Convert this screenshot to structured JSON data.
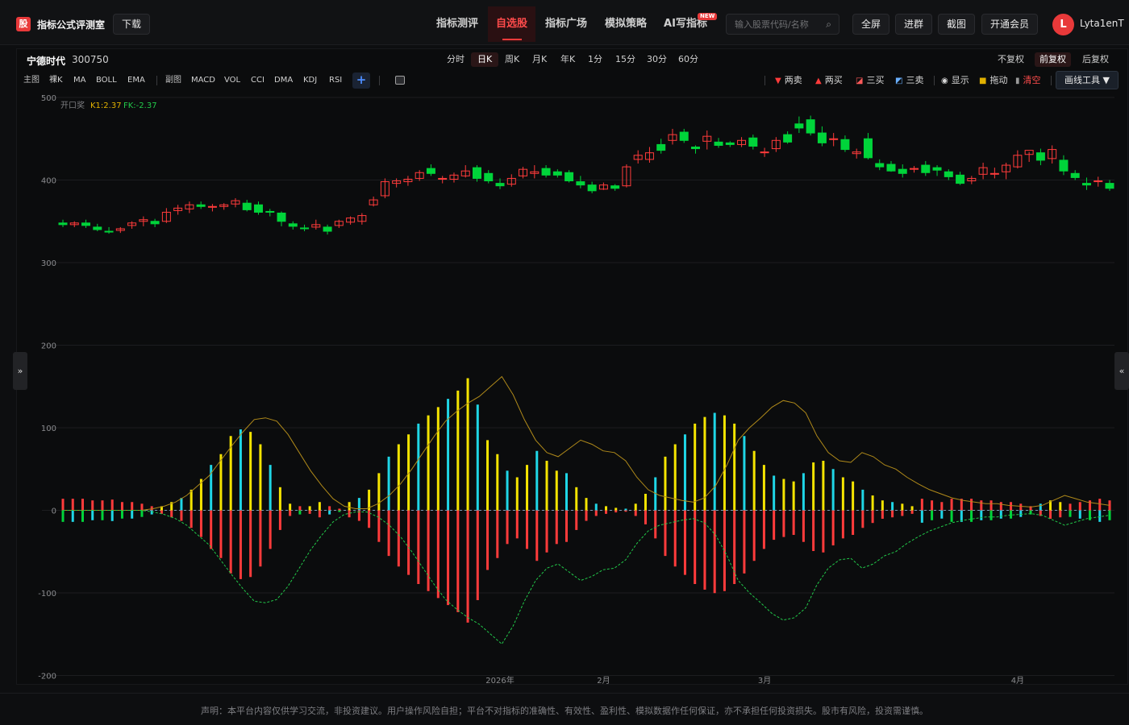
{
  "header": {
    "logo_char": "股",
    "app_title": "指标公式评测室",
    "download_label": "下载",
    "nav": [
      {
        "label": "指标测评",
        "active": false
      },
      {
        "label": "自选股",
        "active": true
      },
      {
        "label": "指标广场",
        "active": false
      },
      {
        "label": "模拟策略",
        "active": false
      },
      {
        "label": "AI写指标",
        "active": false
      }
    ],
    "new_badge": "NEW",
    "search_placeholder": "输入股票代码/名称",
    "buttons": {
      "fullscreen": "全屏",
      "join_group": "进群",
      "screenshot": "截图",
      "membership": "开通会员"
    },
    "user": {
      "avatar_letter": "L",
      "name": "Lyta1enT"
    }
  },
  "stock": {
    "name": "宁德时代",
    "code": "300750"
  },
  "periods": [
    {
      "label": "分时",
      "active": false
    },
    {
      "label": "日K",
      "active": true
    },
    {
      "label": "周K",
      "active": false
    },
    {
      "label": "月K",
      "active": false
    },
    {
      "label": "年K",
      "active": false
    },
    {
      "label": "1分",
      "active": false
    },
    {
      "label": "15分",
      "active": false
    },
    {
      "label": "30分",
      "active": false
    },
    {
      "label": "60分",
      "active": false
    }
  ],
  "adjust": [
    {
      "label": "不复权",
      "active": false
    },
    {
      "label": "前复权",
      "active": true
    },
    {
      "label": "后复权",
      "active": false
    }
  ],
  "indicator_bar": {
    "main_label": "主图",
    "main_items": [
      "裸K",
      "MA",
      "BOLL",
      "EMA"
    ],
    "sub_label": "副图",
    "sub_items": [
      "MACD",
      "VOL",
      "CCI",
      "DMA",
      "KDJ",
      "RSI"
    ],
    "add_label": "+"
  },
  "tools": {
    "two_sell": "两卖",
    "two_buy": "两买",
    "three_buy": "三买",
    "three_sell": "三卖",
    "show": "显示",
    "drag": "拖动",
    "clear": "清空",
    "draw_tools": "画线工具 ▼"
  },
  "colors": {
    "up": "#ff3b3b",
    "down": "#00d43a",
    "k1": "#e0b000",
    "fk": "#22c94a",
    "cyan": "#1fd6e6",
    "yellow": "#f5e400"
  },
  "chart_data": {
    "type": "candlestick+oscillator",
    "legend": {
      "name": "开口奖",
      "k1": "K1:2.37",
      "fk": "FK:-2.37"
    },
    "ylim": [
      -200,
      500
    ],
    "y_ticks": [
      500,
      400,
      300,
      200,
      100,
      0,
      -100,
      -200
    ],
    "x_tick_labels": [
      {
        "label": "2026年",
        "index": 38
      },
      {
        "label": "2月",
        "index": 47
      },
      {
        "label": "3月",
        "index": 61
      },
      {
        "label": "4月",
        "index": 83
      }
    ],
    "candles": [
      [
        348,
        352,
        343,
        346
      ],
      [
        346,
        350,
        343,
        348
      ],
      [
        348,
        352,
        342,
        345
      ],
      [
        343,
        347,
        338,
        340
      ],
      [
        338,
        343,
        335,
        337
      ],
      [
        339,
        343,
        336,
        341
      ],
      [
        345,
        350,
        341,
        348
      ],
      [
        350,
        356,
        344,
        352
      ],
      [
        350,
        353,
        343,
        347
      ],
      [
        350,
        366,
        348,
        361
      ],
      [
        363,
        370,
        358,
        366
      ],
      [
        365,
        374,
        360,
        370
      ],
      [
        370,
        374,
        365,
        368
      ],
      [
        367,
        371,
        362,
        368
      ],
      [
        368,
        372,
        364,
        370
      ],
      [
        371,
        378,
        367,
        375
      ],
      [
        372,
        376,
        362,
        364
      ],
      [
        370,
        374,
        358,
        361
      ],
      [
        362,
        365,
        356,
        361
      ],
      [
        360,
        362,
        344,
        350
      ],
      [
        347,
        350,
        340,
        344
      ],
      [
        342,
        346,
        338,
        341
      ],
      [
        343,
        352,
        340,
        346
      ],
      [
        343,
        346,
        334,
        338
      ],
      [
        345,
        352,
        342,
        350
      ],
      [
        349,
        356,
        346,
        354
      ],
      [
        350,
        360,
        346,
        357
      ],
      [
        370,
        380,
        368,
        376
      ],
      [
        381,
        402,
        378,
        398
      ],
      [
        396,
        402,
        391,
        399
      ],
      [
        398,
        405,
        393,
        401
      ],
      [
        402,
        412,
        399,
        409
      ],
      [
        414,
        419,
        405,
        408
      ],
      [
        401,
        405,
        396,
        402
      ],
      [
        401,
        409,
        397,
        406
      ],
      [
        405,
        418,
        403,
        411
      ],
      [
        415,
        418,
        398,
        402
      ],
      [
        408,
        412,
        396,
        399
      ],
      [
        396,
        402,
        389,
        393
      ],
      [
        395,
        407,
        392,
        402
      ],
      [
        405,
        416,
        402,
        413
      ],
      [
        408,
        418,
        402,
        410
      ],
      [
        414,
        418,
        403,
        406
      ],
      [
        410,
        413,
        403,
        406
      ],
      [
        409,
        412,
        397,
        399
      ],
      [
        398,
        405,
        390,
        394
      ],
      [
        394,
        398,
        384,
        387
      ],
      [
        389,
        397,
        388,
        394
      ],
      [
        393,
        395,
        387,
        390
      ],
      [
        393,
        419,
        391,
        416
      ],
      [
        425,
        436,
        420,
        430
      ],
      [
        425,
        440,
        421,
        433
      ],
      [
        443,
        450,
        432,
        436
      ],
      [
        448,
        462,
        443,
        455
      ],
      [
        458,
        462,
        445,
        448
      ],
      [
        440,
        442,
        432,
        438
      ],
      [
        447,
        460,
        437,
        453
      ],
      [
        446,
        451,
        439,
        442
      ],
      [
        445,
        447,
        440,
        443
      ],
      [
        443,
        452,
        440,
        448
      ],
      [
        451,
        455,
        437,
        441
      ],
      [
        433,
        439,
        428,
        434
      ],
      [
        438,
        452,
        434,
        448
      ],
      [
        455,
        459,
        444,
        446
      ],
      [
        468,
        477,
        457,
        463
      ],
      [
        473,
        478,
        454,
        457
      ],
      [
        457,
        465,
        441,
        445
      ],
      [
        449,
        457,
        441,
        450
      ],
      [
        449,
        454,
        434,
        437
      ],
      [
        432,
        438,
        426,
        434
      ],
      [
        450,
        457,
        425,
        427
      ],
      [
        420,
        425,
        412,
        416
      ],
      [
        419,
        423,
        410,
        411
      ],
      [
        413,
        419,
        403,
        408
      ],
      [
        413,
        417,
        409,
        414
      ],
      [
        418,
        423,
        405,
        409
      ],
      [
        415,
        418,
        405,
        412
      ],
      [
        410,
        413,
        400,
        404
      ],
      [
        406,
        410,
        394,
        396
      ],
      [
        399,
        405,
        395,
        402
      ],
      [
        407,
        421,
        401,
        415
      ],
      [
        407,
        415,
        402,
        408
      ],
      [
        410,
        421,
        401,
        418
      ],
      [
        416,
        436,
        414,
        430
      ],
      [
        431,
        434,
        422,
        436
      ],
      [
        433,
        438,
        418,
        424
      ],
      [
        426,
        442,
        420,
        437
      ],
      [
        424,
        430,
        406,
        411
      ],
      [
        408,
        412,
        400,
        403
      ],
      [
        396,
        403,
        388,
        394
      ],
      [
        398,
        404,
        392,
        399
      ],
      [
        396,
        400,
        387,
        390
      ]
    ],
    "hist": [
      -14,
      -14,
      -14,
      -12,
      -12,
      -13,
      -10,
      -10,
      -8,
      -5,
      5,
      10,
      15,
      25,
      38,
      55,
      68,
      90,
      98,
      95,
      80,
      55,
      28,
      8,
      -5,
      5,
      10,
      -5,
      -2,
      10,
      15,
      25,
      45,
      65,
      80,
      92,
      105,
      115,
      125,
      135,
      145,
      160,
      128,
      85,
      68,
      48,
      40,
      55,
      72,
      60,
      48,
      45,
      28,
      15,
      8,
      5,
      3,
      2,
      8,
      20,
      40,
      65,
      80,
      92,
      105,
      113,
      118,
      115,
      105,
      90,
      72,
      55,
      42,
      38,
      35,
      45,
      58,
      60,
      50,
      40,
      35,
      25,
      18,
      12,
      10,
      8,
      5,
      -15,
      -12,
      -10,
      -14,
      -14,
      -14,
      -12,
      -12,
      -10,
      -10,
      -8,
      -5,
      8,
      12,
      10,
      -8,
      -10,
      -12,
      -14,
      -12
    ],
    "k1_line": [
      0,
      0,
      0,
      0,
      0,
      0,
      0,
      0,
      2,
      5,
      10,
      18,
      30,
      42,
      60,
      78,
      95,
      110,
      112,
      108,
      92,
      70,
      48,
      30,
      14,
      5,
      2,
      2,
      8,
      18,
      32,
      50,
      70,
      90,
      108,
      120,
      130,
      138,
      150,
      162,
      140,
      110,
      85,
      70,
      65,
      75,
      85,
      80,
      72,
      70,
      60,
      40,
      25,
      18,
      15,
      12,
      10,
      15,
      30,
      55,
      85,
      100,
      112,
      125,
      133,
      130,
      118,
      90,
      70,
      60,
      58,
      70,
      65,
      55,
      50,
      40,
      32,
      25,
      20,
      15,
      12,
      10,
      8,
      8,
      6,
      5,
      4,
      6,
      12,
      18,
      14,
      10,
      8,
      6
    ],
    "fk_line": [
      0,
      0,
      0,
      0,
      0,
      0,
      0,
      0,
      -2,
      -5,
      -10,
      -18,
      -30,
      -42,
      -60,
      -78,
      -95,
      -110,
      -112,
      -108,
      -92,
      -70,
      -48,
      -30,
      -14,
      -5,
      -2,
      -2,
      -8,
      -18,
      -32,
      -50,
      -70,
      -90,
      -108,
      -120,
      -130,
      -138,
      -150,
      -162,
      -140,
      -110,
      -85,
      -70,
      -65,
      -75,
      -85,
      -80,
      -72,
      -70,
      -60,
      -40,
      -25,
      -18,
      -15,
      -12,
      -10,
      -15,
      -30,
      -55,
      -85,
      -100,
      -112,
      -125,
      -133,
      -130,
      -118,
      -90,
      -70,
      -60,
      -58,
      -70,
      -65,
      -55,
      -50,
      -40,
      -32,
      -25,
      -20,
      -15,
      -12,
      -10,
      -8,
      -8,
      -6,
      -5,
      -4,
      -6,
      -12,
      -18,
      -14,
      -10,
      -8,
      -6
    ]
  },
  "footer": "声明：本平台内容仅供学习交流，非投资建议。用户操作风险自担；平台不对指标的准确性、有效性、盈利性、模拟数据作任何保证，亦不承担任何投资损失。股市有风险，投资需谨慎。"
}
